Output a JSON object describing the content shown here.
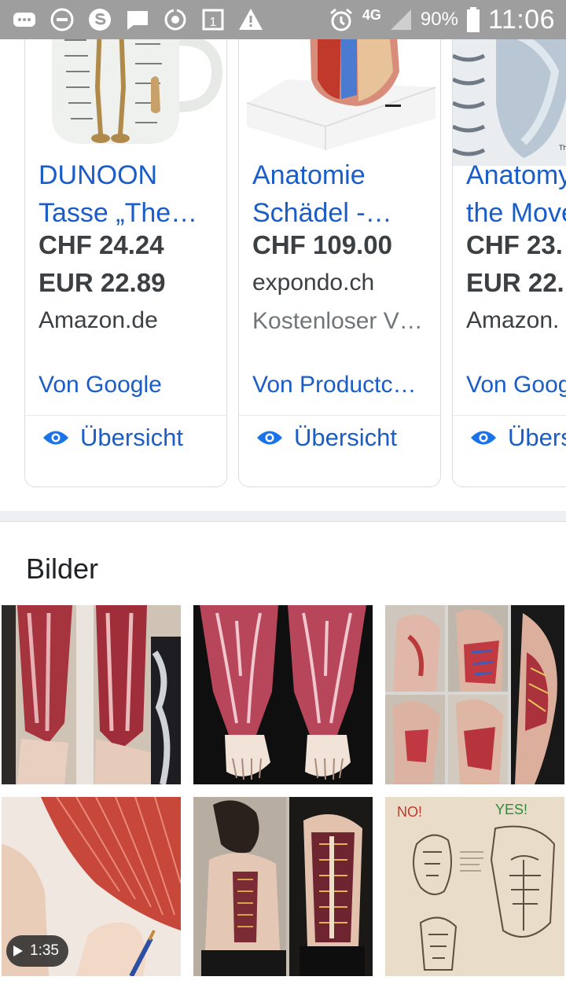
{
  "status_bar": {
    "icons": [
      "messages-icon",
      "do-not-disturb-icon",
      "skype-icon",
      "chat-icon",
      "sync-icon",
      "calendar-icon",
      "warning-icon",
      "alarm-icon"
    ],
    "calendar_day": "1",
    "network": "4G",
    "battery": "90%",
    "time": "11:06"
  },
  "products": [
    {
      "title_line1": "DUNOON",
      "title_line2": "Tasse „The…",
      "price1": "CHF 24.24",
      "price2": "EUR 22.89",
      "seller": "Amazon.de",
      "source": "Von Google",
      "overview": "Übersicht"
    },
    {
      "title_line1": "Anatomie",
      "title_line2": "Schädel -…",
      "price1": "CHF 109.00",
      "seller": "expondo.ch",
      "shipping": "Kostenloser V…",
      "source": "Von Productc…",
      "overview": "Übersicht"
    },
    {
      "title_line1": "Anatomy",
      "title_line2": "the Move",
      "price1": "CHF 23.",
      "price2": "EUR 22.",
      "seller": "Amazon.",
      "source": "Von Google",
      "overview": "Übersicht"
    }
  ],
  "images_section": {
    "title": "Bilder",
    "video_duration": "1:35"
  }
}
